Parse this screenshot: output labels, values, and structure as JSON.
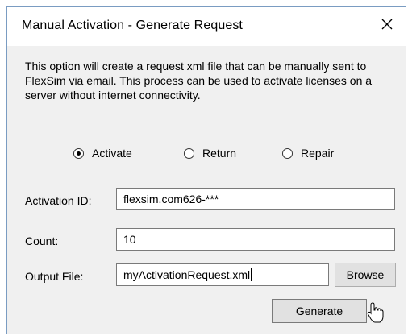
{
  "window": {
    "title": "Manual Activation - Generate Request",
    "close_icon": "close-icon"
  },
  "description": "This option will create a request xml file that can be manually sent to FlexSim via email. This process can be used to activate licenses on a server without internet connectivity.",
  "radios": [
    {
      "label": "Activate",
      "checked": true
    },
    {
      "label": "Return",
      "checked": false
    },
    {
      "label": "Repair",
      "checked": false
    }
  ],
  "fields": {
    "activation_id": {
      "label": "Activation ID:",
      "value": "flexsim.com626-***"
    },
    "count": {
      "label": "Count:",
      "value": "10"
    },
    "output_file": {
      "label": "Output File:",
      "value": "myActivationRequest.xml"
    }
  },
  "buttons": {
    "browse": "Browse",
    "generate": "Generate"
  },
  "colors": {
    "window_bg": "#f0f0f0",
    "titlebar_bg": "#ffffff",
    "button_bg": "#e1e1e1"
  }
}
